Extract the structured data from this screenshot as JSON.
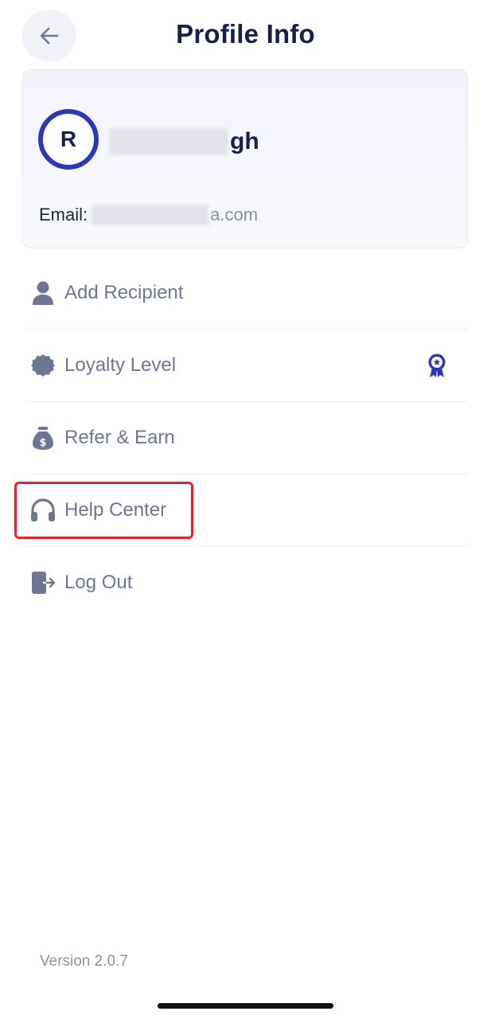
{
  "header": {
    "title": "Profile Info",
    "back_icon": "arrow-left-icon"
  },
  "profile": {
    "avatar_initial": "R",
    "name_visible_suffix": "gh",
    "email_label": "Email:",
    "email_visible_suffix": "a.com"
  },
  "menu": {
    "items": [
      {
        "label": "Add Recipient",
        "icon": "person-icon"
      },
      {
        "label": "Loyalty Level",
        "icon": "badge-icon",
        "trailing_icon": "award-ribbon-icon"
      },
      {
        "label": "Refer & Earn",
        "icon": "money-bag-icon"
      },
      {
        "label": "Help Center",
        "icon": "headphones-icon",
        "highlighted": true
      },
      {
        "label": "Log Out",
        "icon": "logout-icon"
      }
    ]
  },
  "footer": {
    "version": "Version 2.0.7"
  },
  "colors": {
    "title": "#16204a",
    "accent": "#2a3ab5",
    "menu_text": "#6e7791",
    "highlight": "#e8212e"
  }
}
